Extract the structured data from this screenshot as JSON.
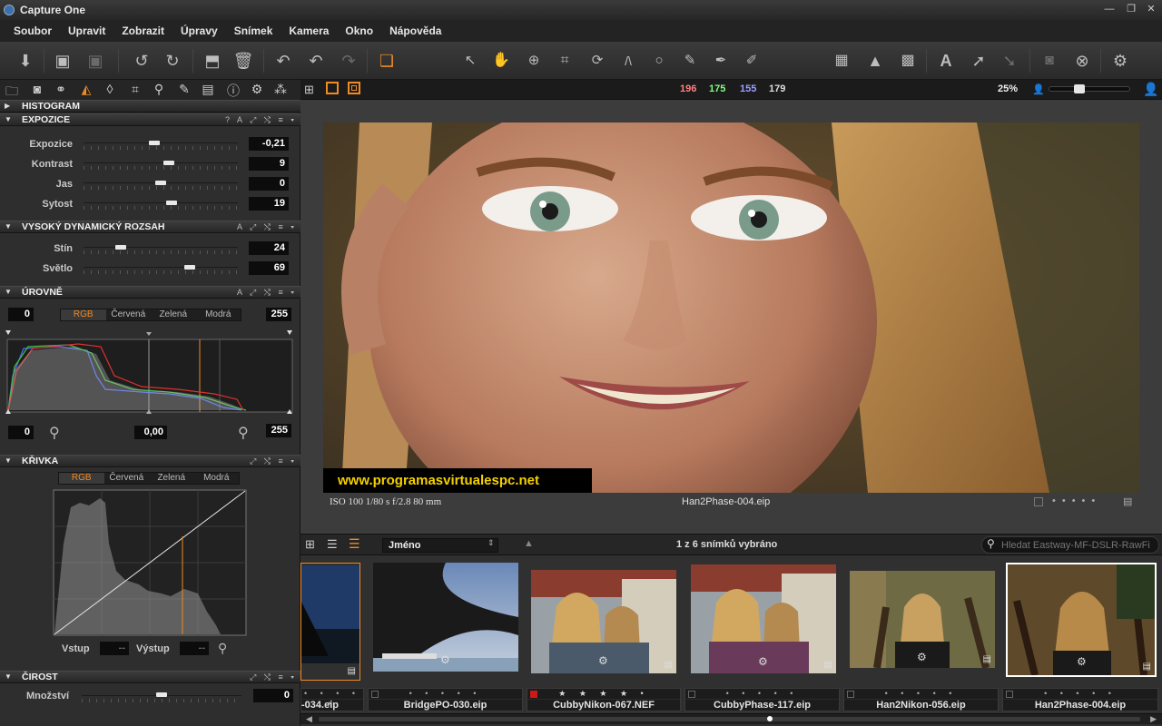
{
  "app": {
    "title": "Capture One"
  },
  "menu": [
    "Soubor",
    "Upravit",
    "Zobrazit",
    "Úpravy",
    "Snímek",
    "Kamera",
    "Okno",
    "Nápověda"
  ],
  "viewer_bar": {
    "r": "196",
    "g": "175",
    "b": "155",
    "l": "179",
    "zoom": "25%"
  },
  "panels": {
    "histogram": {
      "title": "HISTOGRAM"
    },
    "exposure": {
      "title": "EXPOZICE",
      "icons": "? A ⤢ ⤭ ≡ ▾",
      "sliders": [
        {
          "label": "Expozice",
          "value": "-0,21",
          "pos": 0.46
        },
        {
          "label": "Kontrast",
          "value": "9",
          "pos": 0.55
        },
        {
          "label": "Jas",
          "value": "0",
          "pos": 0.5
        },
        {
          "label": "Sytost",
          "value": "19",
          "pos": 0.57
        }
      ]
    },
    "hdr": {
      "title": "VYSOKÝ DYNAMICKÝ ROZSAH",
      "icons": "A ⤢ ⤭ ≡ ▾",
      "sliders": [
        {
          "label": "Stín",
          "value": "24",
          "pos": 0.24
        },
        {
          "label": "Světlo",
          "value": "69",
          "pos": 0.69
        }
      ]
    },
    "levels": {
      "title": "ÚROVNĚ",
      "icons": "A ⤢ ⤭ ≡ ▾",
      "in_low": "0",
      "in_high": "255",
      "out_low": "0",
      "mid": "0,00",
      "out_high": "255",
      "channels": [
        "RGB",
        "Červená",
        "Zelená",
        "Modrá"
      ]
    },
    "curve": {
      "title": "KŘIVKA",
      "icons": "⤢ ⤭ ≡ ▾",
      "channels": [
        "RGB",
        "Červená",
        "Zelená",
        "Modrá"
      ],
      "input_label": "Vstup",
      "output_label": "Výstup",
      "input_val": "--",
      "output_val": "--"
    },
    "sharpen": {
      "title": "ČIROST",
      "icons": "⤢ ⤭ ≡ ▾",
      "slider": {
        "label": "Množství",
        "value": "0",
        "pos": 0.5
      }
    }
  },
  "photo": {
    "watermark": "www.programasvirtualespc.net",
    "exif": "ISO 100  1/80 s  f/2.8  80 mm",
    "filename": "Han2Phase-004.eip"
  },
  "browser": {
    "sort": "Jméno",
    "status": "1 z 6 snímků vybráno",
    "search_placeholder": "Hledat Eastway-MF-DSLR-RawFi",
    "items": [
      {
        "name": "-034.eip",
        "rating": "•  •  •  •  •"
      },
      {
        "name": "BridgePO-030.eip",
        "rating": "•  •  •  •  •"
      },
      {
        "name": "CubbyNikon-067.NEF",
        "rating": "★ ★ ★ ★ •"
      },
      {
        "name": "CubbyPhase-117.eip",
        "rating": "•  •  •  •  •"
      },
      {
        "name": "Han2Nikon-056.eip",
        "rating": "•  •  •  •  •"
      },
      {
        "name": "Han2Phase-004.eip",
        "rating": "•  •  •  •  •"
      }
    ]
  }
}
